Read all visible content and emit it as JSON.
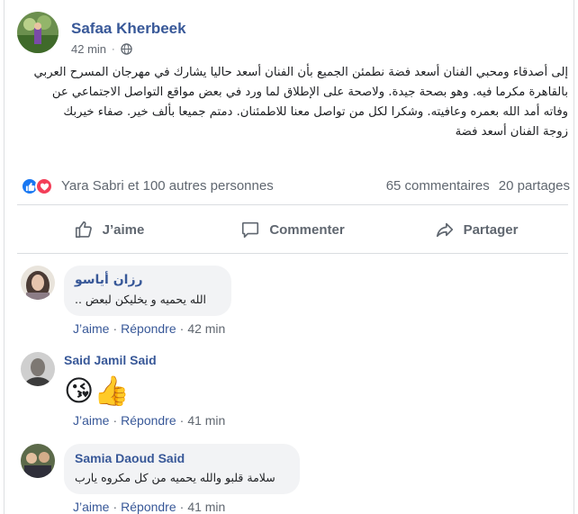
{
  "post": {
    "author": "Safaa Kherbeek",
    "time": "42 min",
    "separator": "·",
    "text_lines": [
      "إلى أصدقاء ومحبي الفنان أسعد فضة نطمئن الجميع بأن الفنان أسعد حاليا يشارك في مهرجان المسرح العربي",
      "بالقاهرة مكرما فيه. وهو بصحة جيدة. ولاصحة على الإطلاق لما ورد في بعض مواقع التواصل الاجتماعي عن",
      "وفاته أمد الله بعمره وعافيته. وشكرا لكل من تواصل معنا للاطمئنان. دمتم جميعا بألف خير. صفاء خيربك",
      "زوجة الفنان أسعد فضة"
    ]
  },
  "stats": {
    "likers": "Yara Sabri et 100 autres personnes",
    "comments": "65 commentaires",
    "shares": "20 partages"
  },
  "actions": {
    "like": "J’aime",
    "comment": "Commenter",
    "share": "Partager"
  },
  "comments": [
    {
      "author": "رزان أياسو",
      "text": "الله يحميه و يخليكن لبعض ..",
      "like": "J’aime",
      "reply": "Répondre",
      "dot": "·",
      "time": "42 min"
    },
    {
      "author": "Said Jamil Said",
      "text": "😘👍",
      "like": "J’aime",
      "reply": "Répondre",
      "dot": "·",
      "time": "41 min"
    },
    {
      "author": "Samia Daoud Said",
      "text": "سلامة قلبو والله يحميه من كل مكروه يارب",
      "like": "J’aime",
      "reply": "Répondre",
      "dot": "·",
      "time": "41 min"
    }
  ],
  "colors": {
    "link": "#385898",
    "like_blue": "#1877f2",
    "love_red": "#f33e58",
    "muted": "#606770"
  },
  "icons": [
    "globe-icon",
    "like-reaction-icon",
    "love-reaction-icon",
    "thumbs-up-icon",
    "comment-icon",
    "share-icon"
  ]
}
